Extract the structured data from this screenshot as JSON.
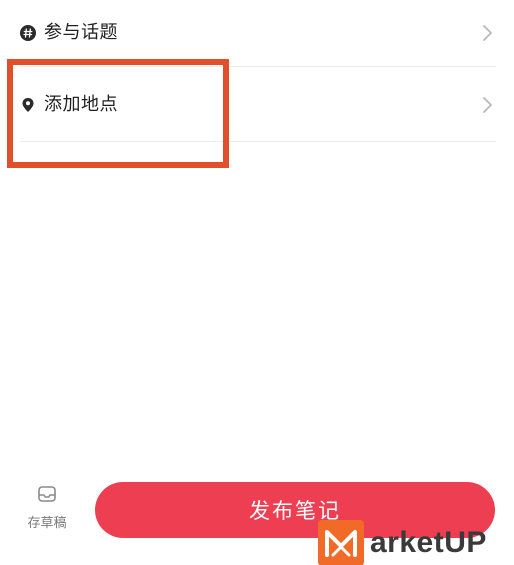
{
  "list": {
    "items": [
      {
        "label": "参与话题",
        "icon": "hashtag-icon",
        "trailing": "chevron-right-icon"
      },
      {
        "label": "添加地点",
        "icon": "location-pin-icon",
        "trailing": "chevron-right-icon"
      }
    ]
  },
  "annotation": {
    "color": "#e14f2b"
  },
  "bottom_bar": {
    "draft_label": "存草稿",
    "draft_icon": "draft-box-icon",
    "publish_label": "发布笔记",
    "publish_color": "#ee3e52"
  },
  "watermark": {
    "text": "arketUP",
    "logo_icon": "m-logo-icon",
    "logo_color": "#f26a28"
  }
}
